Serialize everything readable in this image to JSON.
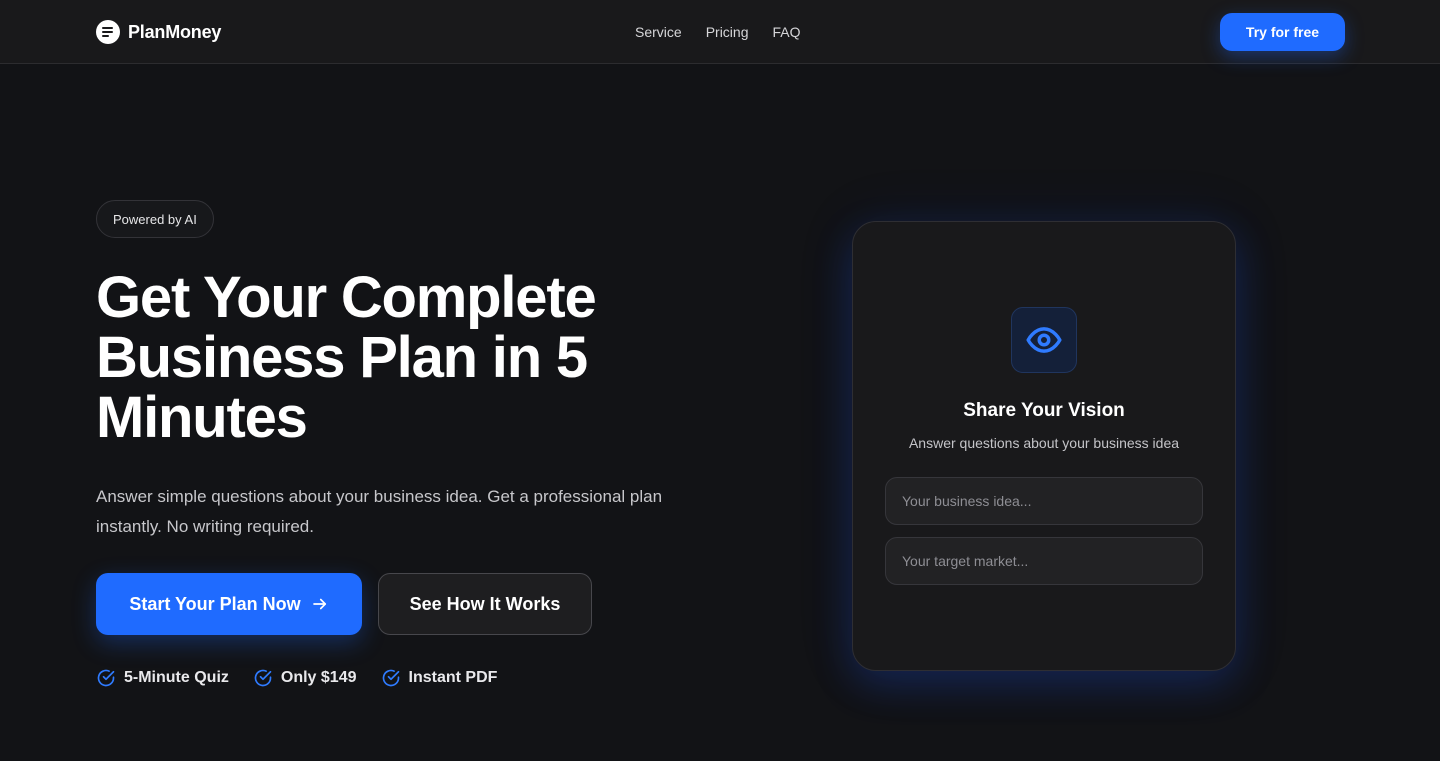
{
  "header": {
    "brand": "PlanMoney",
    "nav": [
      {
        "label": "Service"
      },
      {
        "label": "Pricing"
      },
      {
        "label": "FAQ"
      }
    ],
    "cta_label": "Try for free"
  },
  "hero": {
    "badge": "Powered by AI",
    "title": "Get Your Complete Business Plan in 5 Minutes",
    "subtitle": "Answer simple questions about your business idea. Get a professional plan instantly. No writing required.",
    "primary_cta": "Start Your Plan Now",
    "secondary_cta": "See How It Works",
    "features": [
      {
        "label": "5-Minute Quiz",
        "icon": "check-circle-icon"
      },
      {
        "label": "Only $149",
        "icon": "check-circle-icon"
      },
      {
        "label": "Instant PDF",
        "icon": "check-circle-icon"
      }
    ]
  },
  "card": {
    "icon": "eye-icon",
    "title": "Share Your Vision",
    "subtitle": "Answer questions about your business idea",
    "inputs": [
      {
        "placeholder": "Your business idea...",
        "value": ""
      },
      {
        "placeholder": "Your target market...",
        "value": ""
      }
    ]
  },
  "colors": {
    "accent": "#1f6bff",
    "background": "#121316",
    "header_background": "#19191b",
    "card_background": "#19191b"
  }
}
